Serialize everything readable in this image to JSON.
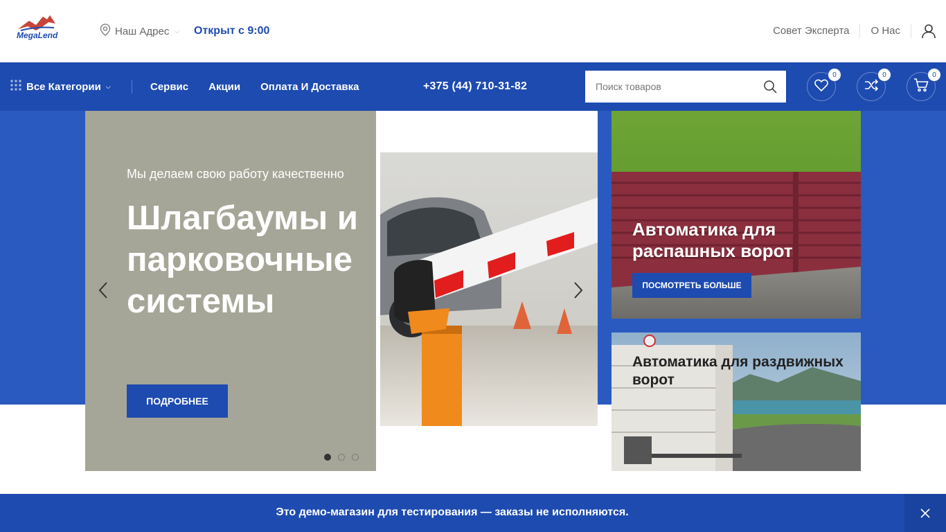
{
  "header": {
    "logo_text": "MegaLend",
    "address_label": "Наш Адрес",
    "open_label": "Открыт с 9:00",
    "links": [
      "Совет Эксперта",
      "О Нас"
    ]
  },
  "nav": {
    "categories_label": "Все Категории",
    "menu": [
      "Сервис",
      "Акции",
      "Оплата И Доставка"
    ],
    "phone": "+375 (44) 710-31-82",
    "search_placeholder": "Поиск товаров",
    "wishlist_count": "0",
    "compare_count": "0",
    "cart_count": "0"
  },
  "slider": {
    "subtitle": "Мы делаем свою работу качественно",
    "title": "Шлагбаумы и парковочные системы",
    "button": "ПОДРОБНЕЕ",
    "dots": 3,
    "active_dot": 0
  },
  "banners": [
    {
      "title": "Автоматика для распашных ворот",
      "button": "ПОСМОТРЕТЬ БОЛЬШЕ"
    },
    {
      "title": "Автоматика для раздвижных ворот"
    }
  ],
  "notice": {
    "text": "Это демо-магазин для тестирования — заказы не исполняются."
  },
  "colors": {
    "primary": "#1e4bb0",
    "hero_bg": "#2a5ac0",
    "slide_bg": "#a6a698"
  }
}
